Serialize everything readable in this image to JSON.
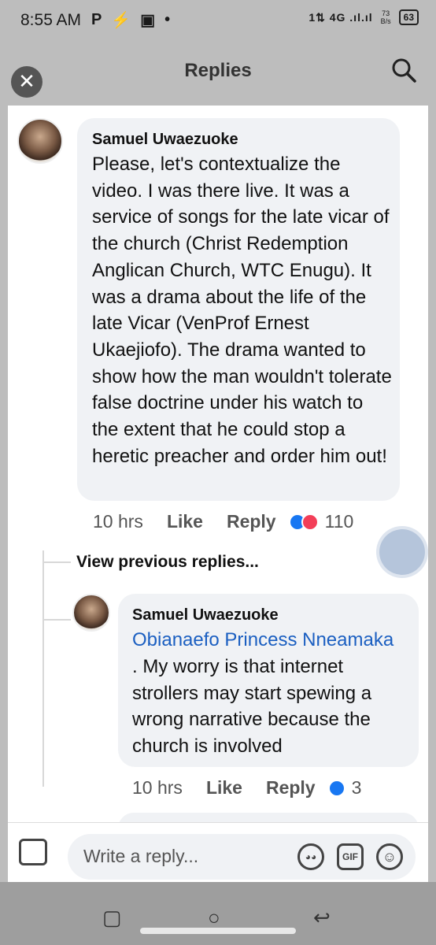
{
  "status_bar": {
    "time": "8:55 AM",
    "left_icons": [
      "P",
      "⚡",
      "▣",
      "•"
    ],
    "net_speed_top": "73",
    "net_speed_bottom": "B/s",
    "signal": "1⇅ 4G .ıl.ıl",
    "battery": "63"
  },
  "header": {
    "title": "Replies",
    "close_glyph": "✕"
  },
  "comments": [
    {
      "author": "Samuel Uwaezuoke",
      "text": "Please, let's contextualize the video. I was there live. It was a service of songs for the late vicar of the church (Christ Redemption Anglican Church, WTC Enugu). It was a drama about the life of the late Vicar (VenProf Ernest Ukaejiofo). The drama wanted to show how the man wouldn't tolerate false doctrine under his watch to the extent that he could stop a heretic preacher and order him out!",
      "time": "10 hrs",
      "like_label": "Like",
      "reply_label": "Reply",
      "reaction_count": "110",
      "reactions": [
        "like-icon",
        "love-icon"
      ]
    },
    {
      "author": "Samuel Uwaezuoke",
      "mention": "Obianaefo Princess Nneamaka",
      "text": ". My worry is that internet strollers may start spewing a wrong narrative because the church is involved",
      "time": "10 hrs",
      "like_label": "Like",
      "reply_label": "Reply",
      "reaction_count": "3",
      "reactions": [
        "like-icon"
      ]
    }
  ],
  "view_previous_label": "View previous replies...",
  "composer": {
    "placeholder": "Write a reply...",
    "gif_label": "GIF"
  },
  "colors": {
    "mention": "#1b5fc1",
    "like": "#1877f2",
    "love": "#f33e58",
    "bubble": "#f0f2f5"
  }
}
